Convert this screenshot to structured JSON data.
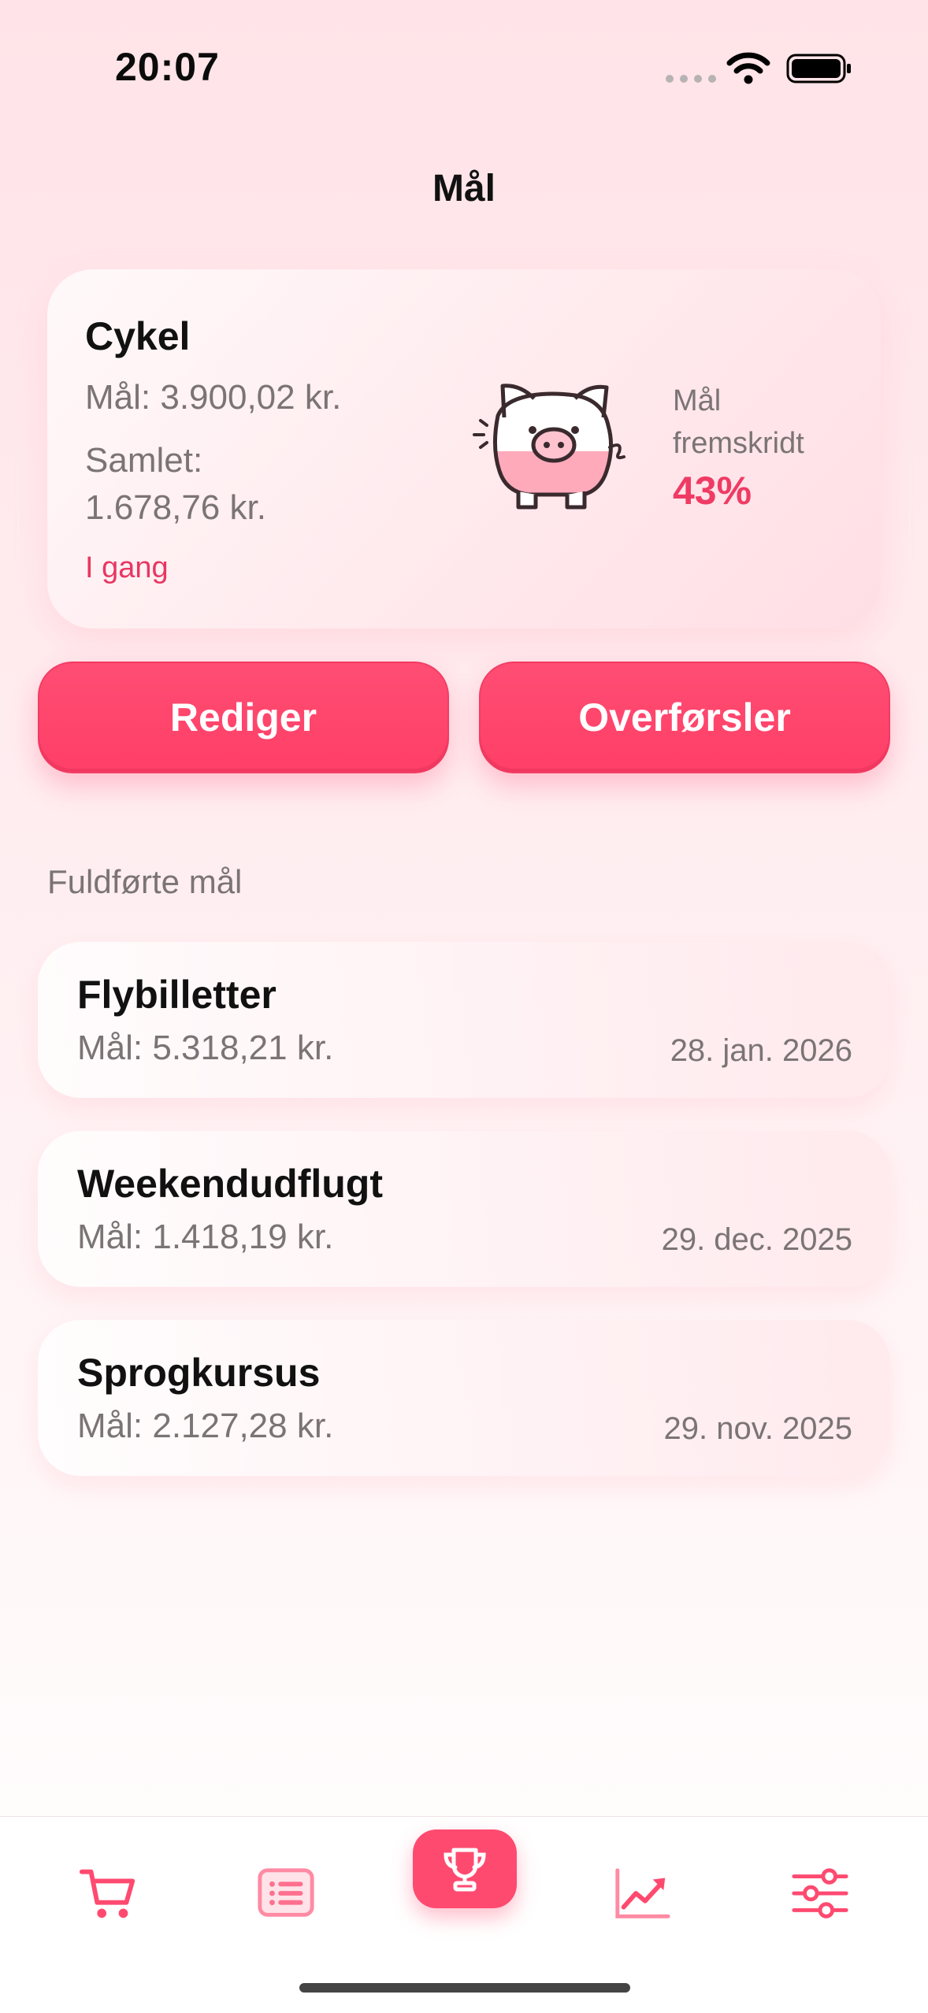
{
  "status_bar": {
    "time": "20:07"
  },
  "page": {
    "title": "Mål"
  },
  "current_goal": {
    "name": "Cykel",
    "target": "Mål: 3.900,02 kr.",
    "saved_label": "Samlet:",
    "saved_value": "1.678,76 kr.",
    "status": "I gang",
    "progress_label": "Mål fremskridt",
    "progress_value": "43%",
    "progress_fraction": 0.43,
    "icon": "piggy-bank-icon"
  },
  "actions": {
    "edit_label": "Rediger",
    "transfers_label": "Overførsler"
  },
  "completed": {
    "title": "Fuldførte mål",
    "items": [
      {
        "name": "Flybilletter",
        "target": "Mål: 5.318,21 kr.",
        "date": "28. jan. 2026"
      },
      {
        "name": "Weekendudflugt",
        "target": "Mål: 1.418,19 kr.",
        "date": "29. dec. 2025"
      },
      {
        "name": "Sprogkursus",
        "target": "Mål: 2.127,28 kr.",
        "date": "29. nov. 2025"
      }
    ]
  },
  "tab_bar": {
    "tabs": [
      "cart-icon",
      "list-icon",
      "trophy-icon",
      "chart-icon",
      "sliders-icon"
    ],
    "active": "trophy-icon"
  },
  "colors": {
    "accent": "#ff4a70",
    "status_text": "#e83762",
    "secondary_text": "#7b7475"
  }
}
